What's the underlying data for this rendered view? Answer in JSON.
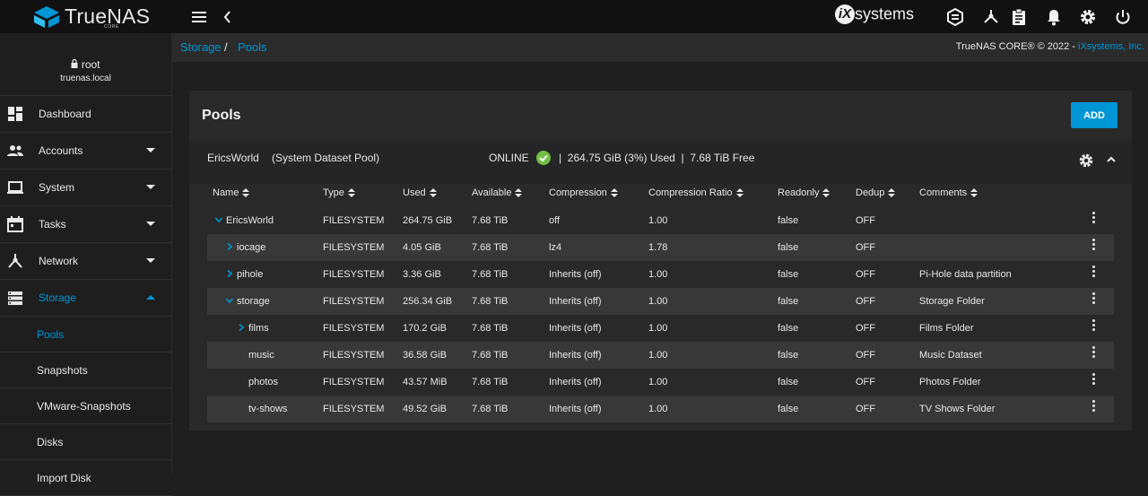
{
  "brand": {
    "name": "TrueNAS",
    "edition": "CORE"
  },
  "vendor": {
    "prefix": "iX",
    "suffix": "systems"
  },
  "colors": {
    "accent": "#0095d5",
    "success": "#71bf44",
    "topbar": "#111111",
    "card": "#292929"
  },
  "topbar_icons": [
    "menu-icon",
    "back-chevron-icon",
    "truecommand-icon",
    "ix-connect-icon",
    "task-manager-icon",
    "notifications-icon",
    "settings-icon",
    "power-icon"
  ],
  "user": {
    "name": "root",
    "host": "truenas.local"
  },
  "sidebar": {
    "items": [
      {
        "label": "Dashboard",
        "icon": "dashboard-icon"
      },
      {
        "label": "Accounts",
        "icon": "accounts-icon"
      },
      {
        "label": "System",
        "icon": "system-laptop-icon"
      },
      {
        "label": "Tasks",
        "icon": "calendar-icon"
      },
      {
        "label": "Network",
        "icon": "network-icon"
      },
      {
        "label": "Storage",
        "icon": "storage-icon"
      }
    ],
    "subitems": [
      "Pools",
      "Snapshots",
      "VMware-Snapshots",
      "Disks",
      "Import Disk"
    ]
  },
  "breadcrumb": {
    "root": "Storage",
    "sep": "/",
    "current": "Pools"
  },
  "copyright": {
    "text": "TrueNAS CORE® © 2022 - ",
    "link": "iXsystems, Inc."
  },
  "pools": {
    "title": "Pools",
    "add_label": "ADD",
    "pool": {
      "name": "EricsWorld",
      "system_label": "(System Dataset Pool)",
      "status": "ONLINE",
      "used": "264.75 GiB (3%) Used",
      "free": "7.68 TiB Free",
      "sep": "|"
    },
    "columns": [
      "Name",
      "Type",
      "Used",
      "Available",
      "Compression",
      "Compression Ratio",
      "Readonly",
      "Dedup",
      "Comments"
    ],
    "rows": [
      {
        "name": "EricsWorld",
        "type": "FILESYSTEM",
        "used": "264.75 GiB",
        "available": "7.68 TiB",
        "compression": "off",
        "ratio": "1.00",
        "readonly": "false",
        "dedup": "OFF",
        "comments": "",
        "level": 0,
        "expander": "expanded"
      },
      {
        "name": "iocage",
        "type": "FILESYSTEM",
        "used": "4.05 GiB",
        "available": "7.68 TiB",
        "compression": "lz4",
        "ratio": "1.78",
        "readonly": "false",
        "dedup": "OFF",
        "comments": "",
        "level": 1,
        "expander": "collapsed"
      },
      {
        "name": "pihole",
        "type": "FILESYSTEM",
        "used": "3.36 GiB",
        "available": "7.68 TiB",
        "compression": "Inherits (off)",
        "ratio": "1.00",
        "readonly": "false",
        "dedup": "OFF",
        "comments": "Pi-Hole data partition",
        "level": 1,
        "expander": "collapsed"
      },
      {
        "name": "storage",
        "type": "FILESYSTEM",
        "used": "256.34 GiB",
        "available": "7.68 TiB",
        "compression": "Inherits (off)",
        "ratio": "1.00",
        "readonly": "false",
        "dedup": "OFF",
        "comments": "Storage Folder",
        "level": 1,
        "expander": "expanded"
      },
      {
        "name": "films",
        "type": "FILESYSTEM",
        "used": "170.2 GiB",
        "available": "7.68 TiB",
        "compression": "Inherits (off)",
        "ratio": "1.00",
        "readonly": "false",
        "dedup": "OFF",
        "comments": "Films Folder",
        "level": 2,
        "expander": "collapsed"
      },
      {
        "name": "music",
        "type": "FILESYSTEM",
        "used": "36.58 GiB",
        "available": "7.68 TiB",
        "compression": "Inherits (off)",
        "ratio": "1.00",
        "readonly": "false",
        "dedup": "OFF",
        "comments": "Music Dataset",
        "level": 2,
        "expander": "none"
      },
      {
        "name": "photos",
        "type": "FILESYSTEM",
        "used": "43.57 MiB",
        "available": "7.68 TiB",
        "compression": "Inherits (off)",
        "ratio": "1.00",
        "readonly": "false",
        "dedup": "OFF",
        "comments": "Photos Folder",
        "level": 2,
        "expander": "none"
      },
      {
        "name": "tv-shows",
        "type": "FILESYSTEM",
        "used": "49.52 GiB",
        "available": "7.68 TiB",
        "compression": "Inherits (off)",
        "ratio": "1.00",
        "readonly": "false",
        "dedup": "OFF",
        "comments": "TV Shows Folder",
        "level": 2,
        "expander": "none"
      }
    ]
  }
}
